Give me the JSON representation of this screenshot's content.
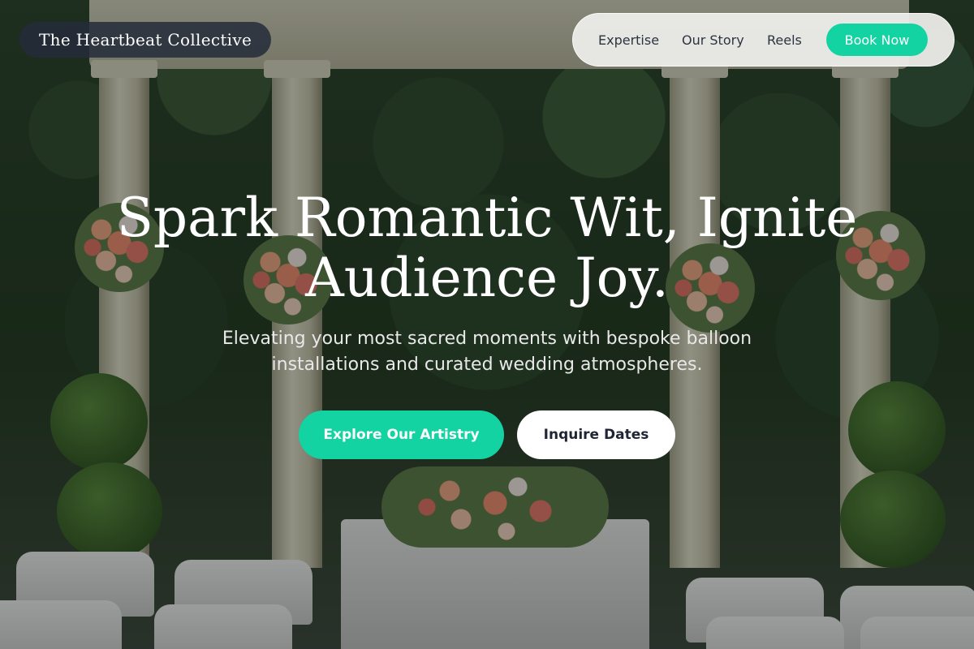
{
  "brand": {
    "name": "The Heartbeat Collective"
  },
  "nav": {
    "links": [
      "Expertise",
      "Our Story",
      "Reels"
    ],
    "cta_label": "Book Now"
  },
  "hero": {
    "title_line1": "Spark Romantic Wit, Ignite",
    "title_line2": "Audience Joy.",
    "subtitle_line1": "Elevating your most sacred moments with bespoke balloon",
    "subtitle_line2": "installations and curated wedding atmospheres.",
    "primary_cta": "Explore Our Artistry",
    "secondary_cta": "Inquire Dates"
  },
  "colors": {
    "accent": "#14d3a2",
    "brand_pill": "#242c3a",
    "nav_bg": "#ececE9",
    "heading_text": "#ffffff"
  }
}
